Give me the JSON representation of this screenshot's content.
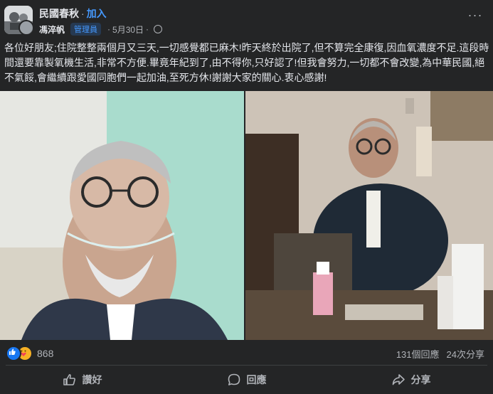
{
  "post": {
    "group_name": "民國春秋",
    "join_label": "加入",
    "author": "馮淬帆",
    "role_badge": "管理員",
    "date": "5月30日",
    "body": "各位好朋友;住院整整兩個月又三天,一切感覺都已麻木!昨天終於出院了,但不算完全康復,因血氧濃度不足.這段時間還要靠製氧機生活,非常不方便.畢竟年紀到了,由不得你,只好認了!但我會努力,一切都不會改變,為中華民國,絕不氣餒,會繼續跟愛國同胞們一起加油,至死方休!謝謝大家的關心.衷心感謝!"
  },
  "stats": {
    "reaction_count": "868",
    "comments": "131個回應",
    "shares": "24次分享",
    "reaction_icons": [
      "like-icon",
      "care-icon"
    ]
  },
  "actions": {
    "like": "讚好",
    "comment": "回應",
    "share": "分享"
  },
  "colors": {
    "background": "#242526",
    "link": "#4599ff",
    "text": "#e4e6eb",
    "muted": "#b0b3b8"
  }
}
